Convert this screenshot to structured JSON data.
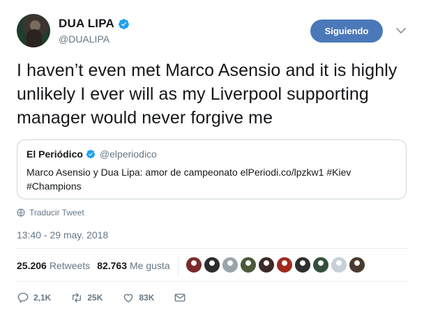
{
  "tweet": {
    "author": {
      "name": "DUA LIPA",
      "handle": "@DUALIPA"
    },
    "follow_label": "Siguiendo",
    "text": "I haven’t even met Marco Asensio and it is highly unlikely I ever will as my Liverpool supporting manager would never forgive me",
    "quote": {
      "name": "El Periódico",
      "handle": "@elperiodico",
      "text": "Marco Asensio y Dua Lipa: amor de campeonato elPeriodi.co/lpzkw1 #Kiev #Champions"
    },
    "translate_label": "Traducir Tweet",
    "timestamp": "13:40 - 29 may. 2018",
    "stats": {
      "retweets_count": "25.206",
      "retweets_label": "Retweets",
      "likes_count": "82.763",
      "likes_label": "Me gusta"
    },
    "actions": {
      "replies": "2,1K",
      "retweets": "25K",
      "likes": "83K"
    }
  },
  "colors": {
    "accent": "#1da1f2",
    "follow_button": "#4b78b8",
    "muted_text": "#657786",
    "border": "#ccd6dd"
  },
  "liker_avatar_colors": [
    "#7a2a2a",
    "#2c2c2c",
    "#9aa4ab",
    "#4a5a3a",
    "#3b2b26",
    "#a02a1e",
    "#2f2f2f",
    "#35503a",
    "#c9cfd6",
    "#4a3a30"
  ]
}
